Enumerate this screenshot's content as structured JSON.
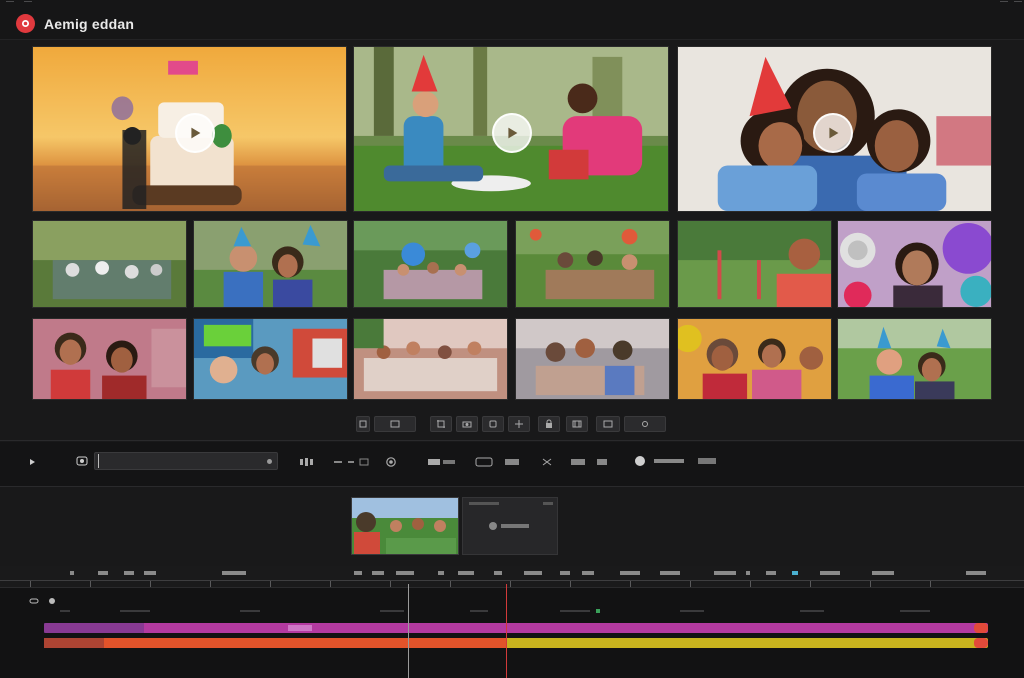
{
  "app": {
    "title": "Aemig eddan",
    "logo_icon": "record-icon",
    "accent": "#e0393e"
  },
  "gallery": {
    "featured": [
      {
        "name": "birthday-cake-sunset",
        "has_play": true
      },
      {
        "name": "party-hat-picnic",
        "has_play": true
      },
      {
        "name": "family-party-hats",
        "has_play": true
      }
    ],
    "grid_row1": [
      "garden-party-crowd",
      "kids-party-hats",
      "outdoor-balloons",
      "backyard-picnic",
      "park-celebration",
      "balloon-portrait"
    ],
    "grid_row2": [
      "family-selfie",
      "kids-party-sign",
      "party-table",
      "group-gathering",
      "family-laughing",
      "kids-hats-outdoor"
    ]
  },
  "toolbar_icons": [
    "select-icon",
    "image-icon",
    "crop-icon",
    "camera-icon",
    "frame-icon",
    "grid-icon",
    "lock-icon",
    "film-icon",
    "settings-icon"
  ],
  "controls": {
    "play_icon": "play-icon",
    "camera_icon": "camera-icon",
    "search_value": "",
    "groups": [
      "audio-icon",
      "text-icon",
      "transition-icon",
      "speed-icon",
      "effects-icon"
    ]
  },
  "preview": {
    "panel_icon": "media-icon"
  },
  "timeline": {
    "playhead_color": "#d23a3a",
    "tracks": [
      {
        "name": "video-track-1",
        "color": "#b33aa0"
      },
      {
        "name": "video-track-2",
        "color": "#c8b31e"
      }
    ]
  }
}
